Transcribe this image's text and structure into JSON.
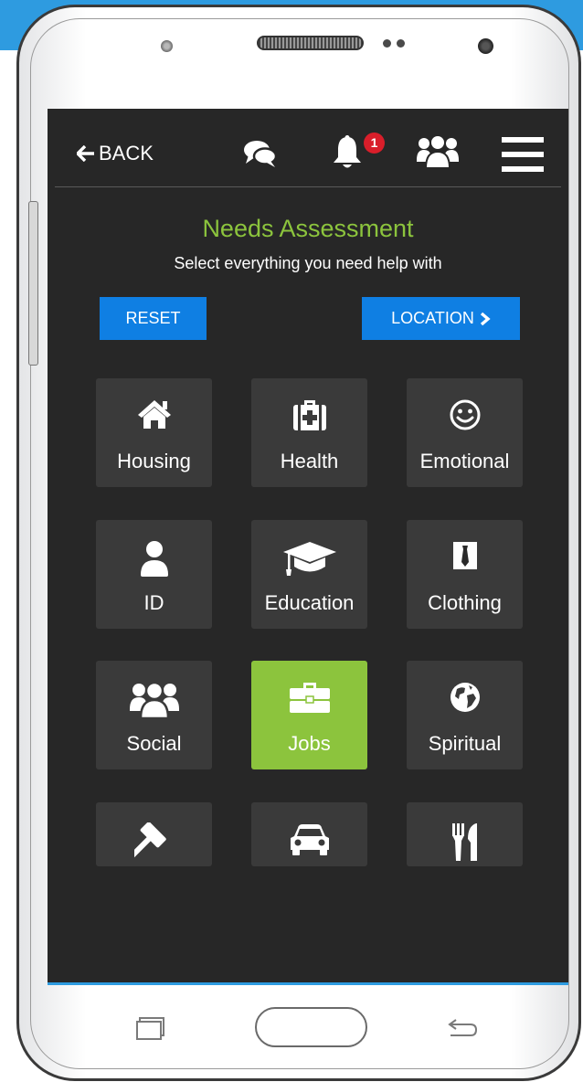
{
  "header": {
    "back_label": "BACK",
    "notification_count": "1",
    "icons": [
      "comments-icon",
      "bell-icon",
      "users-icon",
      "menu-icon"
    ]
  },
  "page": {
    "title": "Needs Assessment",
    "subtitle": "Select everything you need help with"
  },
  "actions": {
    "reset_label": "RESET",
    "location_label": "LOCATION"
  },
  "categories": [
    {
      "label": "Housing",
      "icon": "home-icon",
      "selected": false
    },
    {
      "label": "Health",
      "icon": "medkit-icon",
      "selected": false
    },
    {
      "label": "Emotional",
      "icon": "smile-icon",
      "selected": false
    },
    {
      "label": "ID",
      "icon": "user-icon",
      "selected": false
    },
    {
      "label": "Education",
      "icon": "graduation-cap-icon",
      "selected": false
    },
    {
      "label": "Clothing",
      "icon": "suit-tie-icon",
      "selected": false
    },
    {
      "label": "Social",
      "icon": "group-icon",
      "selected": false
    },
    {
      "label": "Jobs",
      "icon": "briefcase-icon",
      "selected": true
    },
    {
      "label": "Spiritual",
      "icon": "globe-icon",
      "selected": false
    },
    {
      "label": "",
      "icon": "gavel-icon",
      "selected": false
    },
    {
      "label": "",
      "icon": "car-icon",
      "selected": false
    },
    {
      "label": "",
      "icon": "utensils-icon",
      "selected": false
    }
  ],
  "colors": {
    "accent_green": "#8cc43d",
    "button_blue": "#0f7fe3",
    "screen_bg": "#272727",
    "tile_bg": "#3a3a3a",
    "badge_red": "#d91e2a"
  }
}
